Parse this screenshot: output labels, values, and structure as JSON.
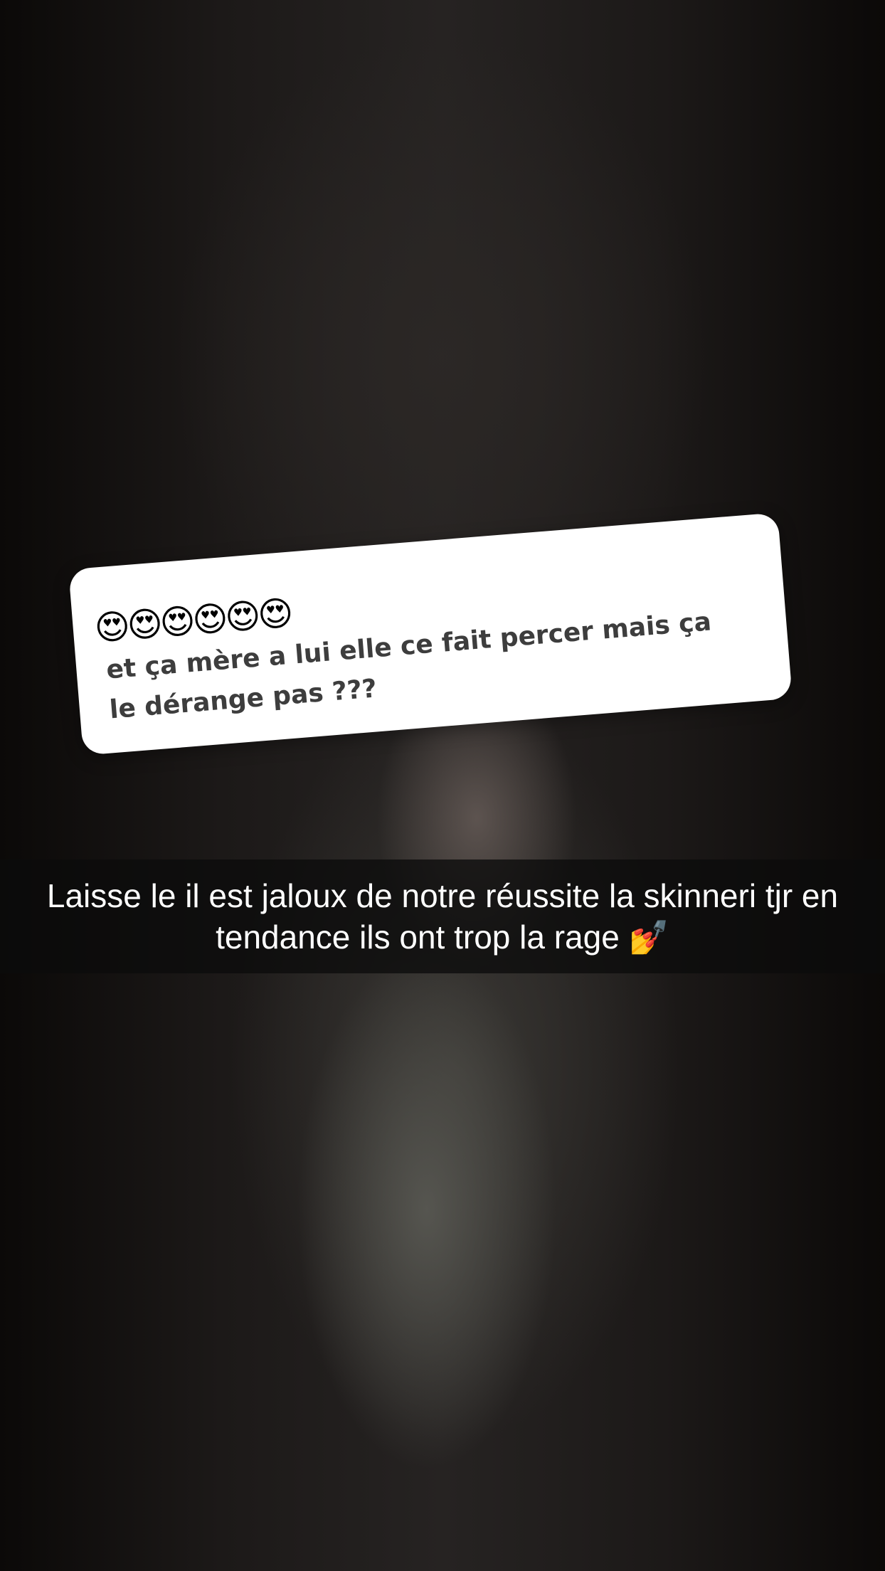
{
  "question_sticker": {
    "emojis": "😍😍😍😍😍😍",
    "text": "et ça mère a lui elle ce fait percer mais ça le dérange pas ???"
  },
  "caption": {
    "text": "Laisse le il est jaloux de notre réussite la skinneri tjr en tendance ils ont trop la rage 💅"
  }
}
